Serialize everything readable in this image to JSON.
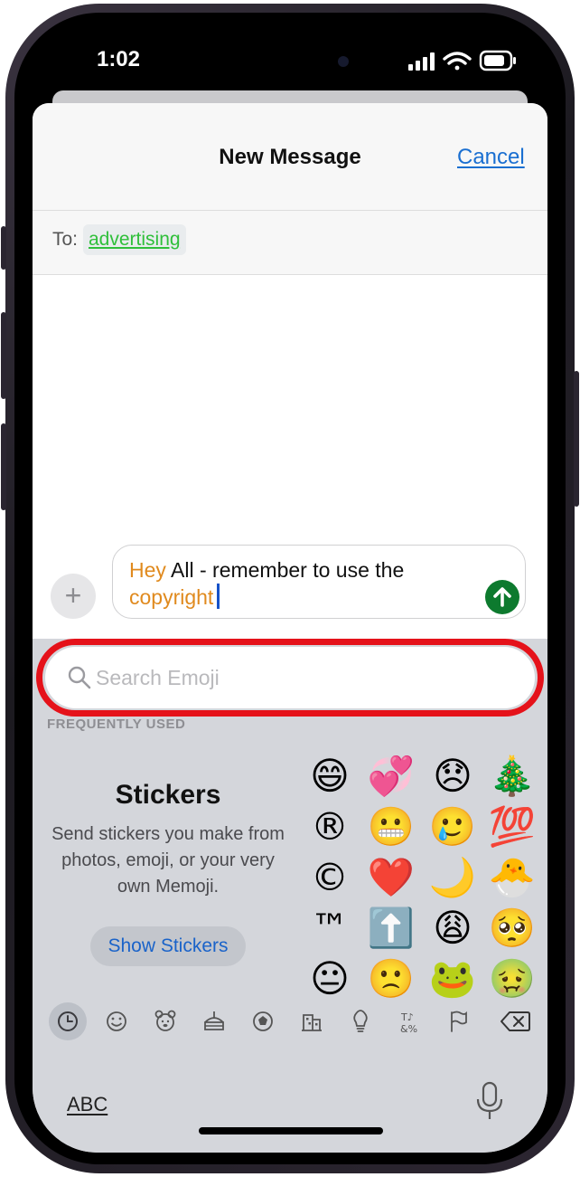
{
  "status_bar": {
    "time": "1:02"
  },
  "header": {
    "title": "New Message",
    "cancel_label": "Cancel"
  },
  "to_field": {
    "label": "To:",
    "recipient": "advertising"
  },
  "compose": {
    "word_hey": "Hey",
    "text_middle": "All - remember to use the",
    "word_copyright": "copyright",
    "plus_label": "+"
  },
  "emoji_keyboard": {
    "search_placeholder": "Search Emoji",
    "section_label": "FREQUENTLY USED",
    "stickers": {
      "title": "Stickers",
      "description": "Send stickers you make from photos, emoji, or your very own Memoji.",
      "button_label": "Show Stickers"
    },
    "emojis": [
      [
        "😄",
        "💞",
        "😞",
        "🎄"
      ],
      [
        "®",
        "😬",
        "🥲",
        "💯"
      ],
      [
        "©",
        "❤️",
        "🌙",
        "🐣"
      ],
      [
        "™",
        "⬆️",
        "😩",
        "🥺"
      ],
      [
        "😐",
        "🙁",
        "🐸",
        "🤢"
      ]
    ],
    "categories": [
      "recent-icon",
      "smiley-icon",
      "animal-icon",
      "food-icon",
      "ball-icon",
      "building-icon",
      "bulb-icon",
      "symbols-icon",
      "flag-icon"
    ],
    "abc_label": "ABC"
  }
}
